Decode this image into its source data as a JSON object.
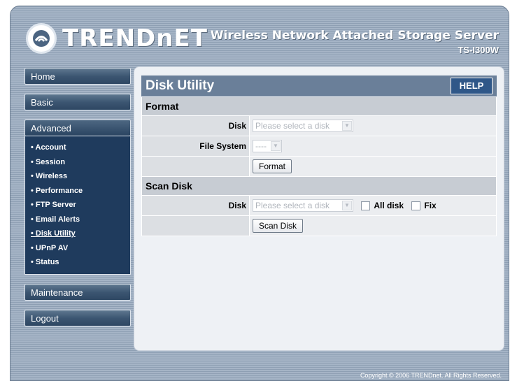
{
  "brand": {
    "name": "TRENDnET",
    "product_title": "Wireless Network Attached Storage Server",
    "model": "TS-I300W",
    "logo_icon": "trendnet-logo-icon"
  },
  "sidebar": {
    "home": "Home",
    "basic": "Basic",
    "advanced": "Advanced",
    "advanced_items": [
      "Account",
      "Session",
      "Wireless",
      "Performance",
      "FTP Server",
      "Email Alerts",
      "Disk Utility",
      "UPnP AV",
      "Status"
    ],
    "maintenance": "Maintenance",
    "logout": "Logout"
  },
  "panel": {
    "title": "Disk Utility",
    "help": "HELP"
  },
  "format": {
    "heading": "Format",
    "disk_label": "Disk",
    "disk_select": "Please select a disk",
    "fs_label": "File System",
    "fs_select": "----",
    "button": "Format"
  },
  "scan": {
    "heading": "Scan Disk",
    "disk_label": "Disk",
    "disk_select": "Please select a disk",
    "all_disk": "All disk",
    "fix": "Fix",
    "button": "Scan Disk"
  },
  "footer": "Copyright © 2006 TRENDnet. All Rights Reserved."
}
